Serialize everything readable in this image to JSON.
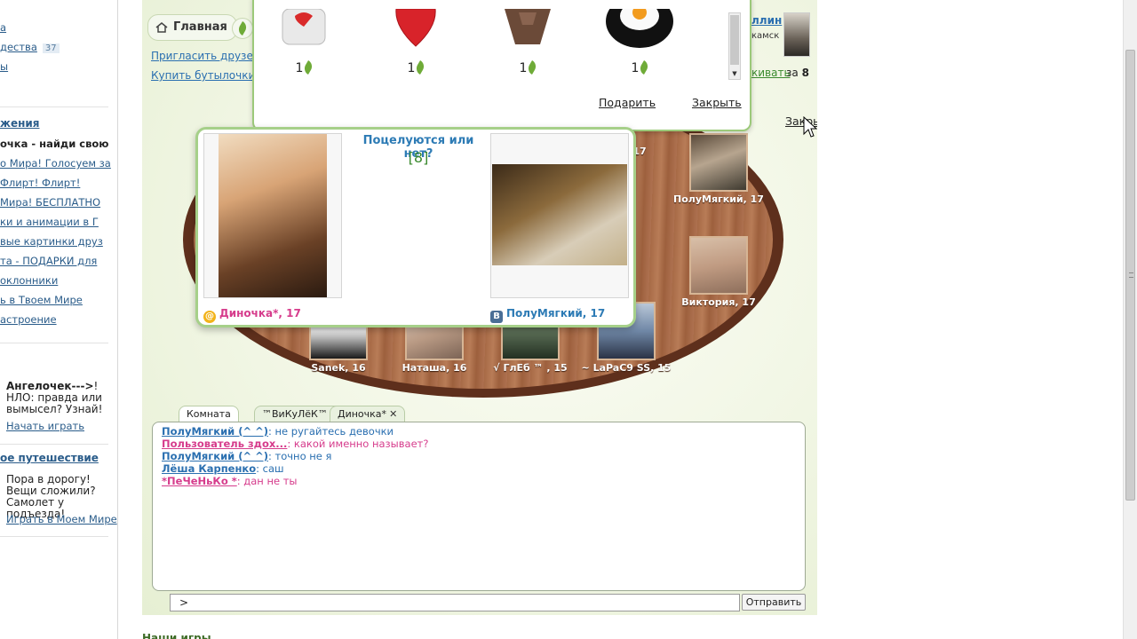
{
  "sidebar": {
    "rows": [
      {
        "text": "а",
        "type": "link"
      },
      {
        "text": "дества",
        "type": "link",
        "badge": "37"
      },
      {
        "text": "ы",
        "type": "link"
      }
    ],
    "section1": {
      "heading": "жения",
      "items": [
        {
          "text": "очка - найди свою",
          "bold": true
        },
        {
          "text": "о Мира! Голосуем за"
        },
        {
          "text": "Флирт! Флирт!"
        },
        {
          "text": "Мира! БЕСПЛАТНО"
        },
        {
          "text": "ки и анимации в Г"
        },
        {
          "text": "вые картинки друз"
        },
        {
          "text": "та - ПОДАРКИ для"
        },
        {
          "text": "оклонники"
        },
        {
          "text": "ь в Твоем Мире"
        },
        {
          "text": "астроение"
        }
      ]
    },
    "section2": {
      "heading": "",
      "text_bold": "Ангелочек--->",
      "text_rest": "! НЛО: правда или вымысел? Узнай!",
      "link": "Начать играть"
    },
    "section3": {
      "heading": "ое путешествие",
      "text": "Пора в дорогу! Вещи сложили? Самолет у подъезда!",
      "link": "Играть в Моем Мире"
    }
  },
  "app": {
    "home_tab": "Главная",
    "invite_link": "Пригласить друзей",
    "buy_link": "Купить бутылочки",
    "top_right": {
      "user": "ллин",
      "city": "камск",
      "link": "кивать",
      "za_prefix": "за",
      "za_value": "8",
      "close": "Закрыть"
    },
    "bottom_text": "Наши игры"
  },
  "gift_popup": {
    "gifts": [
      {
        "icon": "heart-box-icon",
        "price": "1"
      },
      {
        "icon": "red-heart-icon",
        "price": "1"
      },
      {
        "icon": "chocolate-icon",
        "price": "1"
      },
      {
        "icon": "fried-egg-icon",
        "price": "1"
      }
    ],
    "give_button": "Подарить",
    "close_button": "Закрыть"
  },
  "kiss_popup": {
    "question": "Поцелуются или нет?",
    "count": "[8]",
    "left": {
      "name": "Диночка*, 17",
      "network": "mail"
    },
    "right": {
      "name": "ПолуМягкий, 17",
      "network": "vk"
    }
  },
  "players": [
    {
      "name": "ПолуМягкий, 17"
    },
    {
      "name": "Виктория, 17"
    },
    {
      "name": ", 17"
    },
    {
      "name": "Sanek, 16"
    },
    {
      "name": "Наташа, 16"
    },
    {
      "name": "√ ГлЕб ™ , 15"
    },
    {
      "name": "~ LaPaC9 SS, 15"
    }
  ],
  "chat": {
    "tabs": [
      {
        "label": "Комната",
        "active": true,
        "closable": false
      },
      {
        "label": "™ВиКуЛёК™",
        "active": false,
        "closable": true
      },
      {
        "label": "Диночка*",
        "active": false,
        "closable": true
      }
    ],
    "messages": [
      {
        "nick": "ПолуМягкий  (^ ^)",
        "color": "blue",
        "text": ": не ругайтесь девочки"
      },
      {
        "nick": "Пользователь здох...",
        "color": "pink",
        "text": ": какой именно называет?"
      },
      {
        "nick": "ПолуМягкий  (^ ^)",
        "color": "blue",
        "text": ": точно не я"
      },
      {
        "nick": "Лёша Карпенко",
        "color": "blue",
        "text": ": саш"
      },
      {
        "nick": "*ПеЧеНьКо *",
        "color": "pink",
        "text": ": дан не ты"
      }
    ],
    "input_value": ">",
    "send_button": "Отправить"
  },
  "colors": {
    "link_blue": "#2a6fb0",
    "nick_pink": "#d63c8c",
    "accent_green": "#9cc97a",
    "board_wood": "#a76a46"
  }
}
